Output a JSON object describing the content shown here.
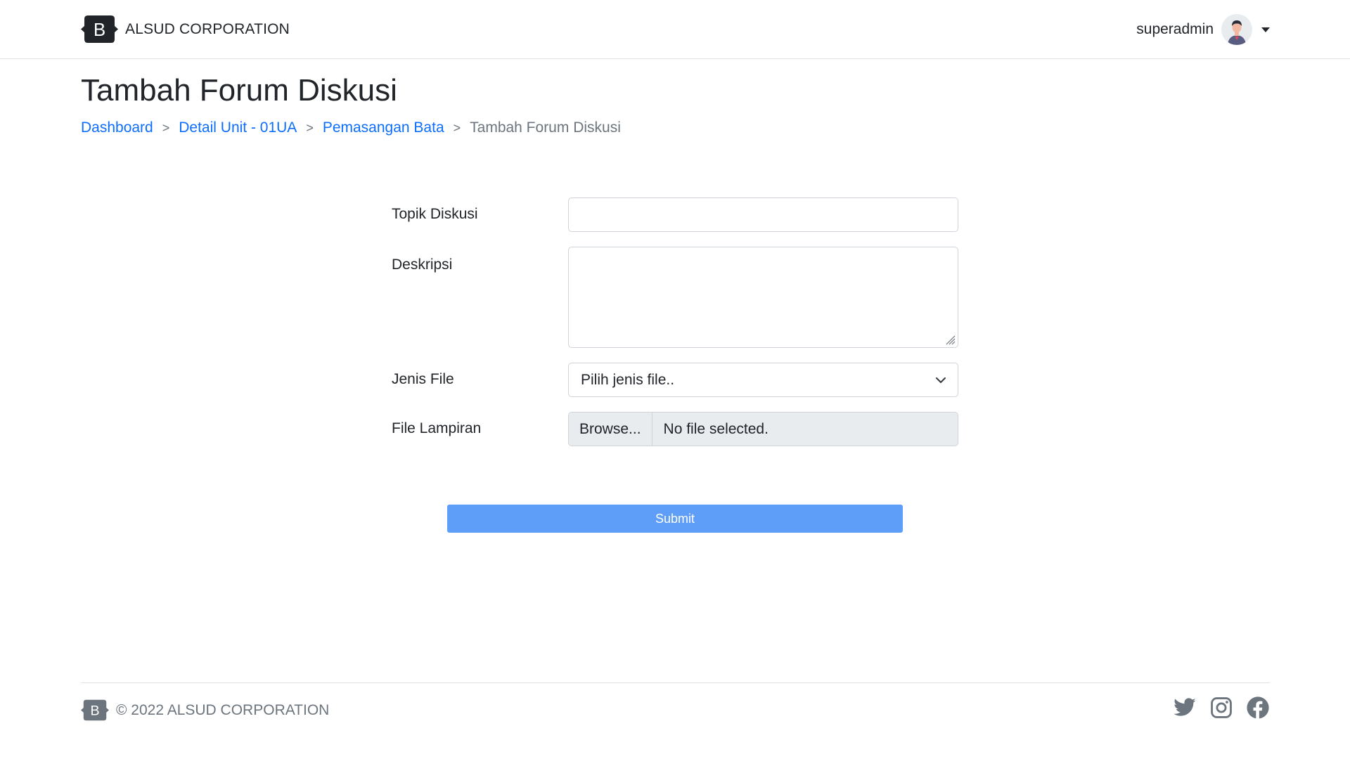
{
  "header": {
    "brand_name": "ALSUD CORPORATION",
    "brand_logo_letter": "B",
    "username": "superadmin"
  },
  "page": {
    "title": "Tambah Forum Diskusi"
  },
  "breadcrumb": {
    "items": [
      {
        "label": "Dashboard"
      },
      {
        "label": "Detail Unit - 01UA"
      },
      {
        "label": "Pemasangan Bata"
      }
    ],
    "separator": ">",
    "active": "Tambah Forum Diskusi"
  },
  "form": {
    "topic_label": "Topik Diskusi",
    "topic_value": "",
    "description_label": "Deskripsi",
    "description_value": "",
    "file_type_label": "Jenis File",
    "file_type_selected": "Pilih jenis file..",
    "attachment_label": "File Lampiran",
    "browse_label": "Browse...",
    "file_status": "No file selected.",
    "submit_label": "Submit"
  },
  "footer": {
    "copyright": "© 2022 ALSUD CORPORATION",
    "social_icons": [
      "twitter-icon",
      "instagram-icon",
      "facebook-icon"
    ]
  },
  "colors": {
    "link": "#0d6efd",
    "submit": "#5e9ef8",
    "muted": "#6c757d",
    "logo_dark": "#212529"
  }
}
